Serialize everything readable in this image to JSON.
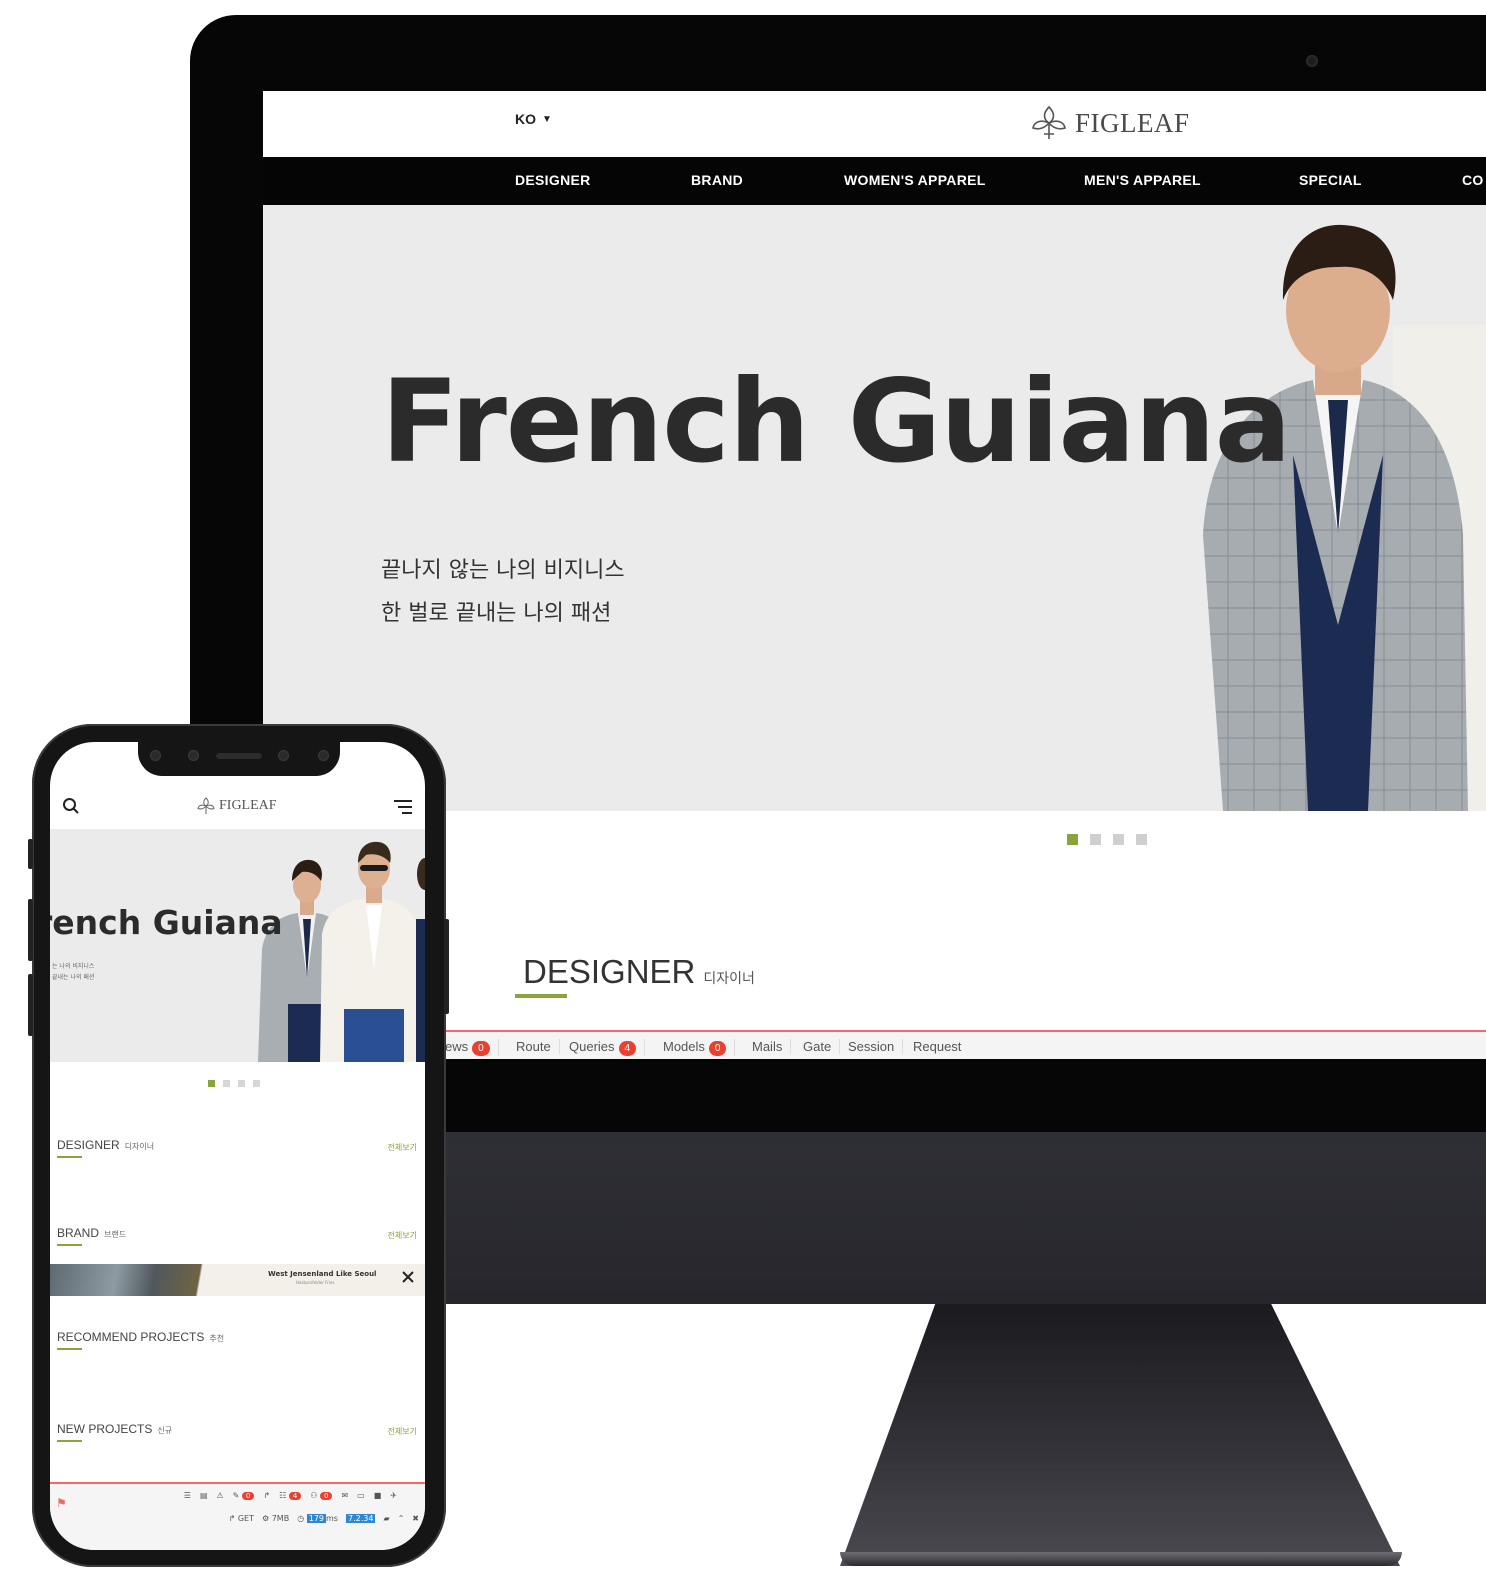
{
  "desktop": {
    "language": "KO",
    "brand": "FIGLEAF",
    "nav": [
      "DESIGNER",
      "BRAND",
      "WOMEN'S APPAREL",
      "MEN'S APPAREL",
      "SPECIAL",
      "CO"
    ],
    "hero": {
      "title": "French Guiana",
      "subtitle_line1": "끝나지 않는 나의 비지니스",
      "subtitle_line2": "한 벌로 끝내는 나의 패션"
    },
    "slider_dots": 4,
    "active_dot": 1,
    "section": {
      "title": "DESIGNER",
      "title_ko": "디자이너"
    },
    "debugbar": {
      "views_label": "ews",
      "views_count": "0",
      "route": "Route",
      "queries_label": "Queries",
      "queries_count": "4",
      "models_label": "Models",
      "models_count": "0",
      "mails": "Mails",
      "gate": "Gate",
      "session": "Session",
      "request": "Request"
    }
  },
  "mobile": {
    "brand": "FIGLEAF",
    "hero_title": "rench Guiana",
    "hero_sub_line1": "는 나의 비지니스",
    "hero_sub_line2": "끝내는 나의 패션",
    "sections": [
      {
        "title": "DESIGNER",
        "title_ko": "디자이너",
        "more": "전체보기"
      },
      {
        "title": "BRAND",
        "title_ko": "브랜드",
        "more": "전체보기"
      },
      {
        "title": "RECOMMEND PROJECTS",
        "title_ko": "추천",
        "more": ""
      },
      {
        "title": "NEW PROJECTS",
        "title_ko": "신규",
        "more": "전체보기"
      }
    ],
    "banner": {
      "title": "West Jensenland Like Seoul",
      "subtitle": "Hasbarsfeldor Fries"
    },
    "debug": {
      "count_a": "0",
      "count_b": "4",
      "count_c": "0",
      "method": "GET",
      "memory": "7MB",
      "time_value": "179",
      "time_unit": "ms",
      "version": "7.2.34"
    }
  },
  "colors": {
    "accent": "#8aa33b",
    "debug_red": "#e8412f",
    "nav_bg": "#050505",
    "hero_bg": "#ebebeb"
  }
}
